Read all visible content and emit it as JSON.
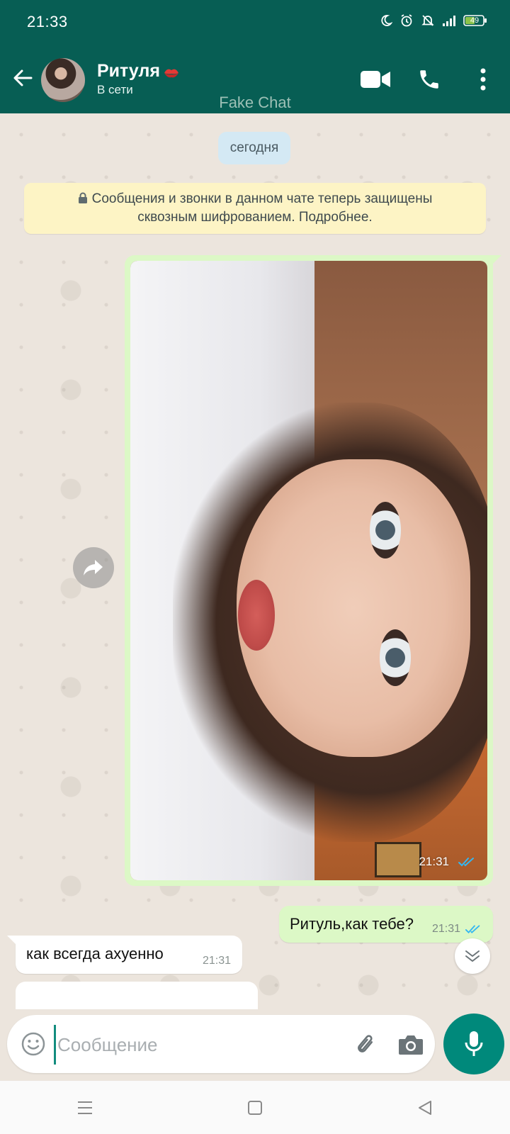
{
  "status_bar": {
    "time": "21:33",
    "battery": "49"
  },
  "header": {
    "contact_name": "Ритуля",
    "contact_status": "В сети",
    "watermark": "Fake Chat",
    "icons": [
      "back-arrow-icon",
      "kiss-icon",
      "video-call-icon",
      "phone-icon",
      "more-vert-icon"
    ]
  },
  "chat": {
    "date_label": "сегодня",
    "e2e_notice": "Сообщения и звонки в данном чате теперь защищены сквозным шифрованием. Подробнее.",
    "messages": [
      {
        "type": "image",
        "direction": "outgoing",
        "time": "21:31",
        "status": "read"
      },
      {
        "type": "text",
        "direction": "outgoing",
        "text": "Ритуль,как тебе?",
        "time": "21:31",
        "status": "read"
      },
      {
        "type": "text",
        "direction": "incoming",
        "text": "как всегда ахуенно",
        "time": "21:31"
      }
    ]
  },
  "composer": {
    "placeholder": "Сообщение",
    "value": "",
    "icons": [
      "emoji-icon",
      "paperclip-icon",
      "camera-icon",
      "mic-icon"
    ]
  },
  "colors": {
    "header": "#075e54",
    "outgoing_bubble": "#dcf8c6",
    "incoming_bubble": "#ffffff",
    "read_ticks": "#34b7f1",
    "mic_button": "#00897b",
    "date_chip": "#d4e9f4",
    "notice": "#fdf4c5"
  }
}
